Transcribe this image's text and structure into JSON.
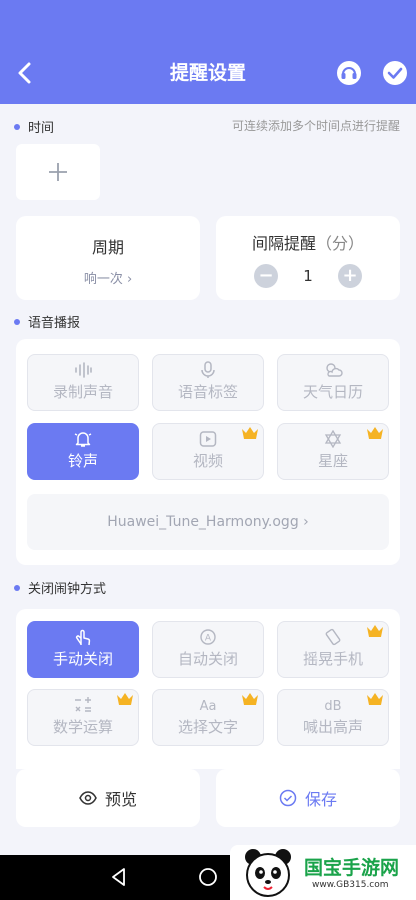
{
  "header": {
    "title": "提醒设置"
  },
  "time_section": {
    "label": "时间",
    "hint": "可连续添加多个时间点进行提醒"
  },
  "period": {
    "title": "周期",
    "value": "响一次 ›"
  },
  "interval": {
    "title": "间隔提醒",
    "unit": "（分）",
    "value": "1",
    "minus": "−",
    "plus": "+"
  },
  "voice_section": {
    "label": "语音播报",
    "options": [
      {
        "label": "录制声音",
        "icon": "waveform-icon",
        "active": false,
        "premium": false
      },
      {
        "label": "语音标签",
        "icon": "microphone-icon",
        "active": false,
        "premium": false
      },
      {
        "label": "天气日历",
        "icon": "weather-icon",
        "active": false,
        "premium": false
      },
      {
        "label": "铃声",
        "icon": "bell-icon",
        "active": true,
        "premium": false
      },
      {
        "label": "视频",
        "icon": "video-icon",
        "active": false,
        "premium": true
      },
      {
        "label": "星座",
        "icon": "star-of-david-icon",
        "active": false,
        "premium": true
      }
    ],
    "file": "Huawei_Tune_Harmony.ogg  ›"
  },
  "close_section": {
    "label": "关闭闹钟方式",
    "options": [
      {
        "label": "手动关闭",
        "icon": "hand-pointer-icon",
        "active": true,
        "premium": false
      },
      {
        "label": "自动关闭",
        "icon": "auto-icon",
        "active": false,
        "premium": false
      },
      {
        "label": "摇晃手机",
        "icon": "shake-phone-icon",
        "active": false,
        "premium": true
      },
      {
        "label": "数学运算",
        "icon": "math-icon",
        "active": false,
        "premium": true,
        "glyph": "−+\n×="
      },
      {
        "label": "选择文字",
        "icon": "text-icon",
        "active": false,
        "premium": true,
        "glyph": "Aa"
      },
      {
        "label": "喊出高声",
        "icon": "decibel-icon",
        "active": false,
        "premium": true,
        "glyph": "dB"
      }
    ]
  },
  "bottom": {
    "preview": "预览",
    "save": "保存"
  },
  "watermark": {
    "brand": "国宝手游网",
    "url": "www.GB315.com"
  },
  "colors": {
    "accent": "#6b7af2",
    "crown": "#f5b324",
    "bg": "#f3f4fa"
  }
}
